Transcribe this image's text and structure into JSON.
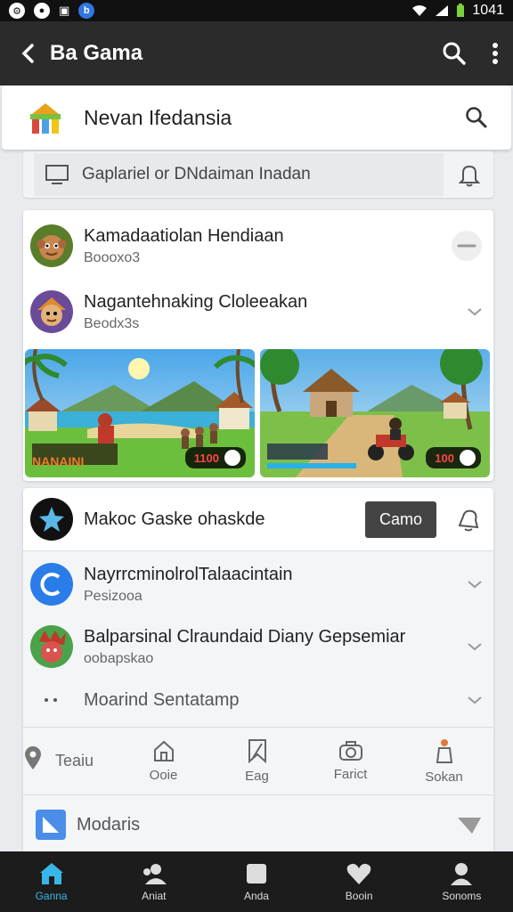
{
  "status_bar": {
    "time": "1041",
    "icons": [
      "circle-icon",
      "circle-icon",
      "sim-icon",
      "blue-badge-icon"
    ]
  },
  "app_bar": {
    "title": "Ba Gama"
  },
  "search": {
    "query": "Nevan Ifedansia"
  },
  "filter": {
    "placeholder": "Gaplariel or DNdaiman Inadan"
  },
  "card1": {
    "items": [
      {
        "title": "Kamadaatiolan Hendiaan",
        "sub": "Boooxo3"
      },
      {
        "title": "Nagantehnaking Cloleeakan",
        "sub": "Beodx3s"
      }
    ],
    "thumbs": [
      {
        "caption": "NANAINI",
        "badge": "1100"
      },
      {
        "caption": "",
        "badge": "100"
      }
    ]
  },
  "card2": {
    "header_title": "Makoc Gaske ohaskde",
    "header_button": "Camo",
    "items": [
      {
        "title": "NayrrcminolrolTalaacintain",
        "sub": "Pesizooa"
      },
      {
        "title": "Balparsinal Clraundaid Diany Gepsemiar",
        "sub": "oobapskao"
      },
      {
        "title": "Moarind Sentatamp",
        "sub": ""
      }
    ],
    "tabs": [
      {
        "label": "Teaiu"
      },
      {
        "label": "Ooie"
      },
      {
        "label": "Eag"
      },
      {
        "label": "Farict"
      },
      {
        "label": "Sokan"
      }
    ],
    "footer_label": "Modaris"
  },
  "bottom_nav": [
    {
      "label": "Ganna",
      "active": true
    },
    {
      "label": "Aniat"
    },
    {
      "label": "Anda"
    },
    {
      "label": "Booin"
    },
    {
      "label": "Sonoms"
    }
  ],
  "colors": {
    "app_bar": "#2b2b2b",
    "accent": "#38b6e8",
    "nav_bg": "#1c1c1c"
  }
}
